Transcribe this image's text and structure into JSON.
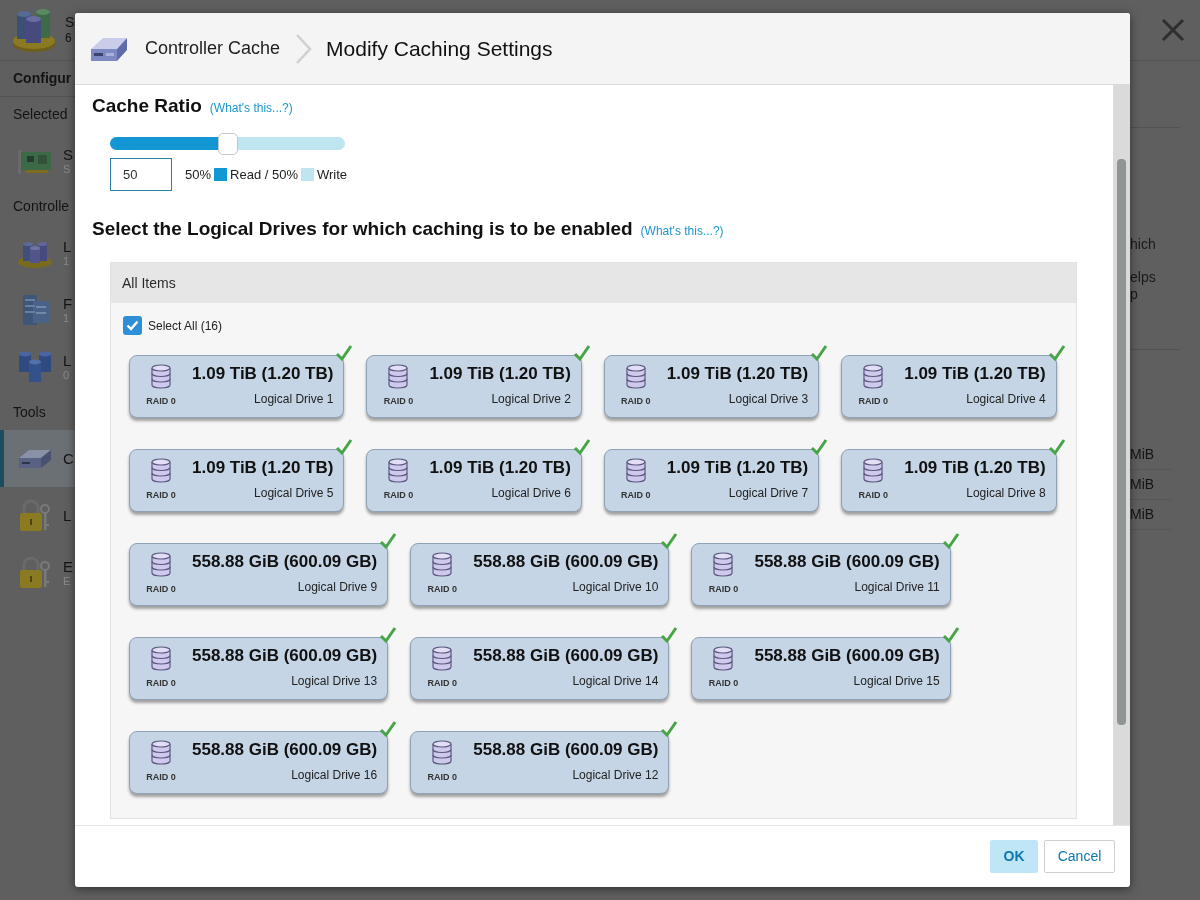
{
  "background": {
    "header": {
      "title": "S",
      "subtitle": "6"
    },
    "sidebar": {
      "title": "Configur",
      "sections": [
        {
          "label": "Selected",
          "items": [
            {
              "kind": "card",
              "label": "S",
              "detail": "S",
              "selected": false
            }
          ]
        },
        {
          "label": "Controlle",
          "items": [
            {
              "kind": "array",
              "label": "L",
              "detail": "1",
              "selected": false
            },
            {
              "kind": "server",
              "label": "F",
              "detail": "1",
              "selected": false
            },
            {
              "kind": "drives",
              "label": "L",
              "detail": "0",
              "selected": false
            }
          ]
        },
        {
          "label": "Tools",
          "items": [
            {
              "kind": "bay",
              "label": "C",
              "selected": true
            },
            {
              "kind": "lock",
              "label": "L",
              "selected": false
            },
            {
              "kind": "lock",
              "label": "E",
              "detail": "E",
              "selected": false
            }
          ]
        }
      ]
    },
    "panel": {
      "lines": [
        "hich",
        "elps",
        "p"
      ],
      "values": [
        "MiB",
        "MiB",
        "MiB"
      ]
    }
  },
  "dialog": {
    "breadcrumb": {
      "parent": "Controller Cache",
      "title": "Modify Caching Settings"
    },
    "cache_ratio": {
      "label": "Cache Ratio",
      "help": "(What's this...?)",
      "level": 0.5,
      "value": "50",
      "legend": {
        "prefix": "50%",
        "items": [
          {
            "label": "Read / 50%",
            "color": "#1296d4"
          },
          {
            "label": "Write",
            "color": "#bfe5f0"
          }
        ]
      }
    },
    "drives_section": {
      "label": "Select the Logical Drives for which caching is to be enabled",
      "help": "(What's this...?)",
      "list_title": "All Items",
      "select_all": {
        "label": "Select All (16)",
        "checked": true
      },
      "drives": [
        {
          "capacity": "1.09 TiB (1.20 TB)",
          "raid": "RAID 0",
          "name": "Logical Drive 1",
          "checked": true
        },
        {
          "capacity": "1.09 TiB (1.20 TB)",
          "raid": "RAID 0",
          "name": "Logical Drive 2",
          "checked": true
        },
        {
          "capacity": "1.09 TiB (1.20 TB)",
          "raid": "RAID 0",
          "name": "Logical Drive 3",
          "checked": true
        },
        {
          "capacity": "1.09 TiB (1.20 TB)",
          "raid": "RAID 0",
          "name": "Logical Drive 4",
          "checked": true
        },
        {
          "capacity": "1.09 TiB (1.20 TB)",
          "raid": "RAID 0",
          "name": "Logical Drive 5",
          "checked": true
        },
        {
          "capacity": "1.09 TiB (1.20 TB)",
          "raid": "RAID 0",
          "name": "Logical Drive 6",
          "checked": true
        },
        {
          "capacity": "1.09 TiB (1.20 TB)",
          "raid": "RAID 0",
          "name": "Logical Drive 7",
          "checked": true
        },
        {
          "capacity": "1.09 TiB (1.20 TB)",
          "raid": "RAID 0",
          "name": "Logical Drive 8",
          "checked": true
        },
        {
          "capacity": "558.88 GiB (600.09 GB)",
          "raid": "RAID 0",
          "name": "Logical Drive 9",
          "checked": true
        },
        {
          "capacity": "558.88 GiB (600.09 GB)",
          "raid": "RAID 0",
          "name": "Logical Drive 10",
          "checked": true
        },
        {
          "capacity": "558.88 GiB (600.09 GB)",
          "raid": "RAID 0",
          "name": "Logical Drive 11",
          "checked": true
        },
        {
          "capacity": "558.88 GiB (600.09 GB)",
          "raid": "RAID 0",
          "name": "Logical Drive 13",
          "checked": true
        },
        {
          "capacity": "558.88 GiB (600.09 GB)",
          "raid": "RAID 0",
          "name": "Logical Drive 14",
          "checked": true
        },
        {
          "capacity": "558.88 GiB (600.09 GB)",
          "raid": "RAID 0",
          "name": "Logical Drive 15",
          "checked": true
        },
        {
          "capacity": "558.88 GiB (600.09 GB)",
          "raid": "RAID 0",
          "name": "Logical Drive 16",
          "checked": true
        },
        {
          "capacity": "558.88 GiB (600.09 GB)",
          "raid": "RAID 0",
          "name": "Logical Drive 12",
          "checked": true
        }
      ]
    },
    "buttons": [
      {
        "label": "OK",
        "kind": "primary"
      },
      {
        "label": "Cancel",
        "kind": "secondary"
      }
    ]
  }
}
